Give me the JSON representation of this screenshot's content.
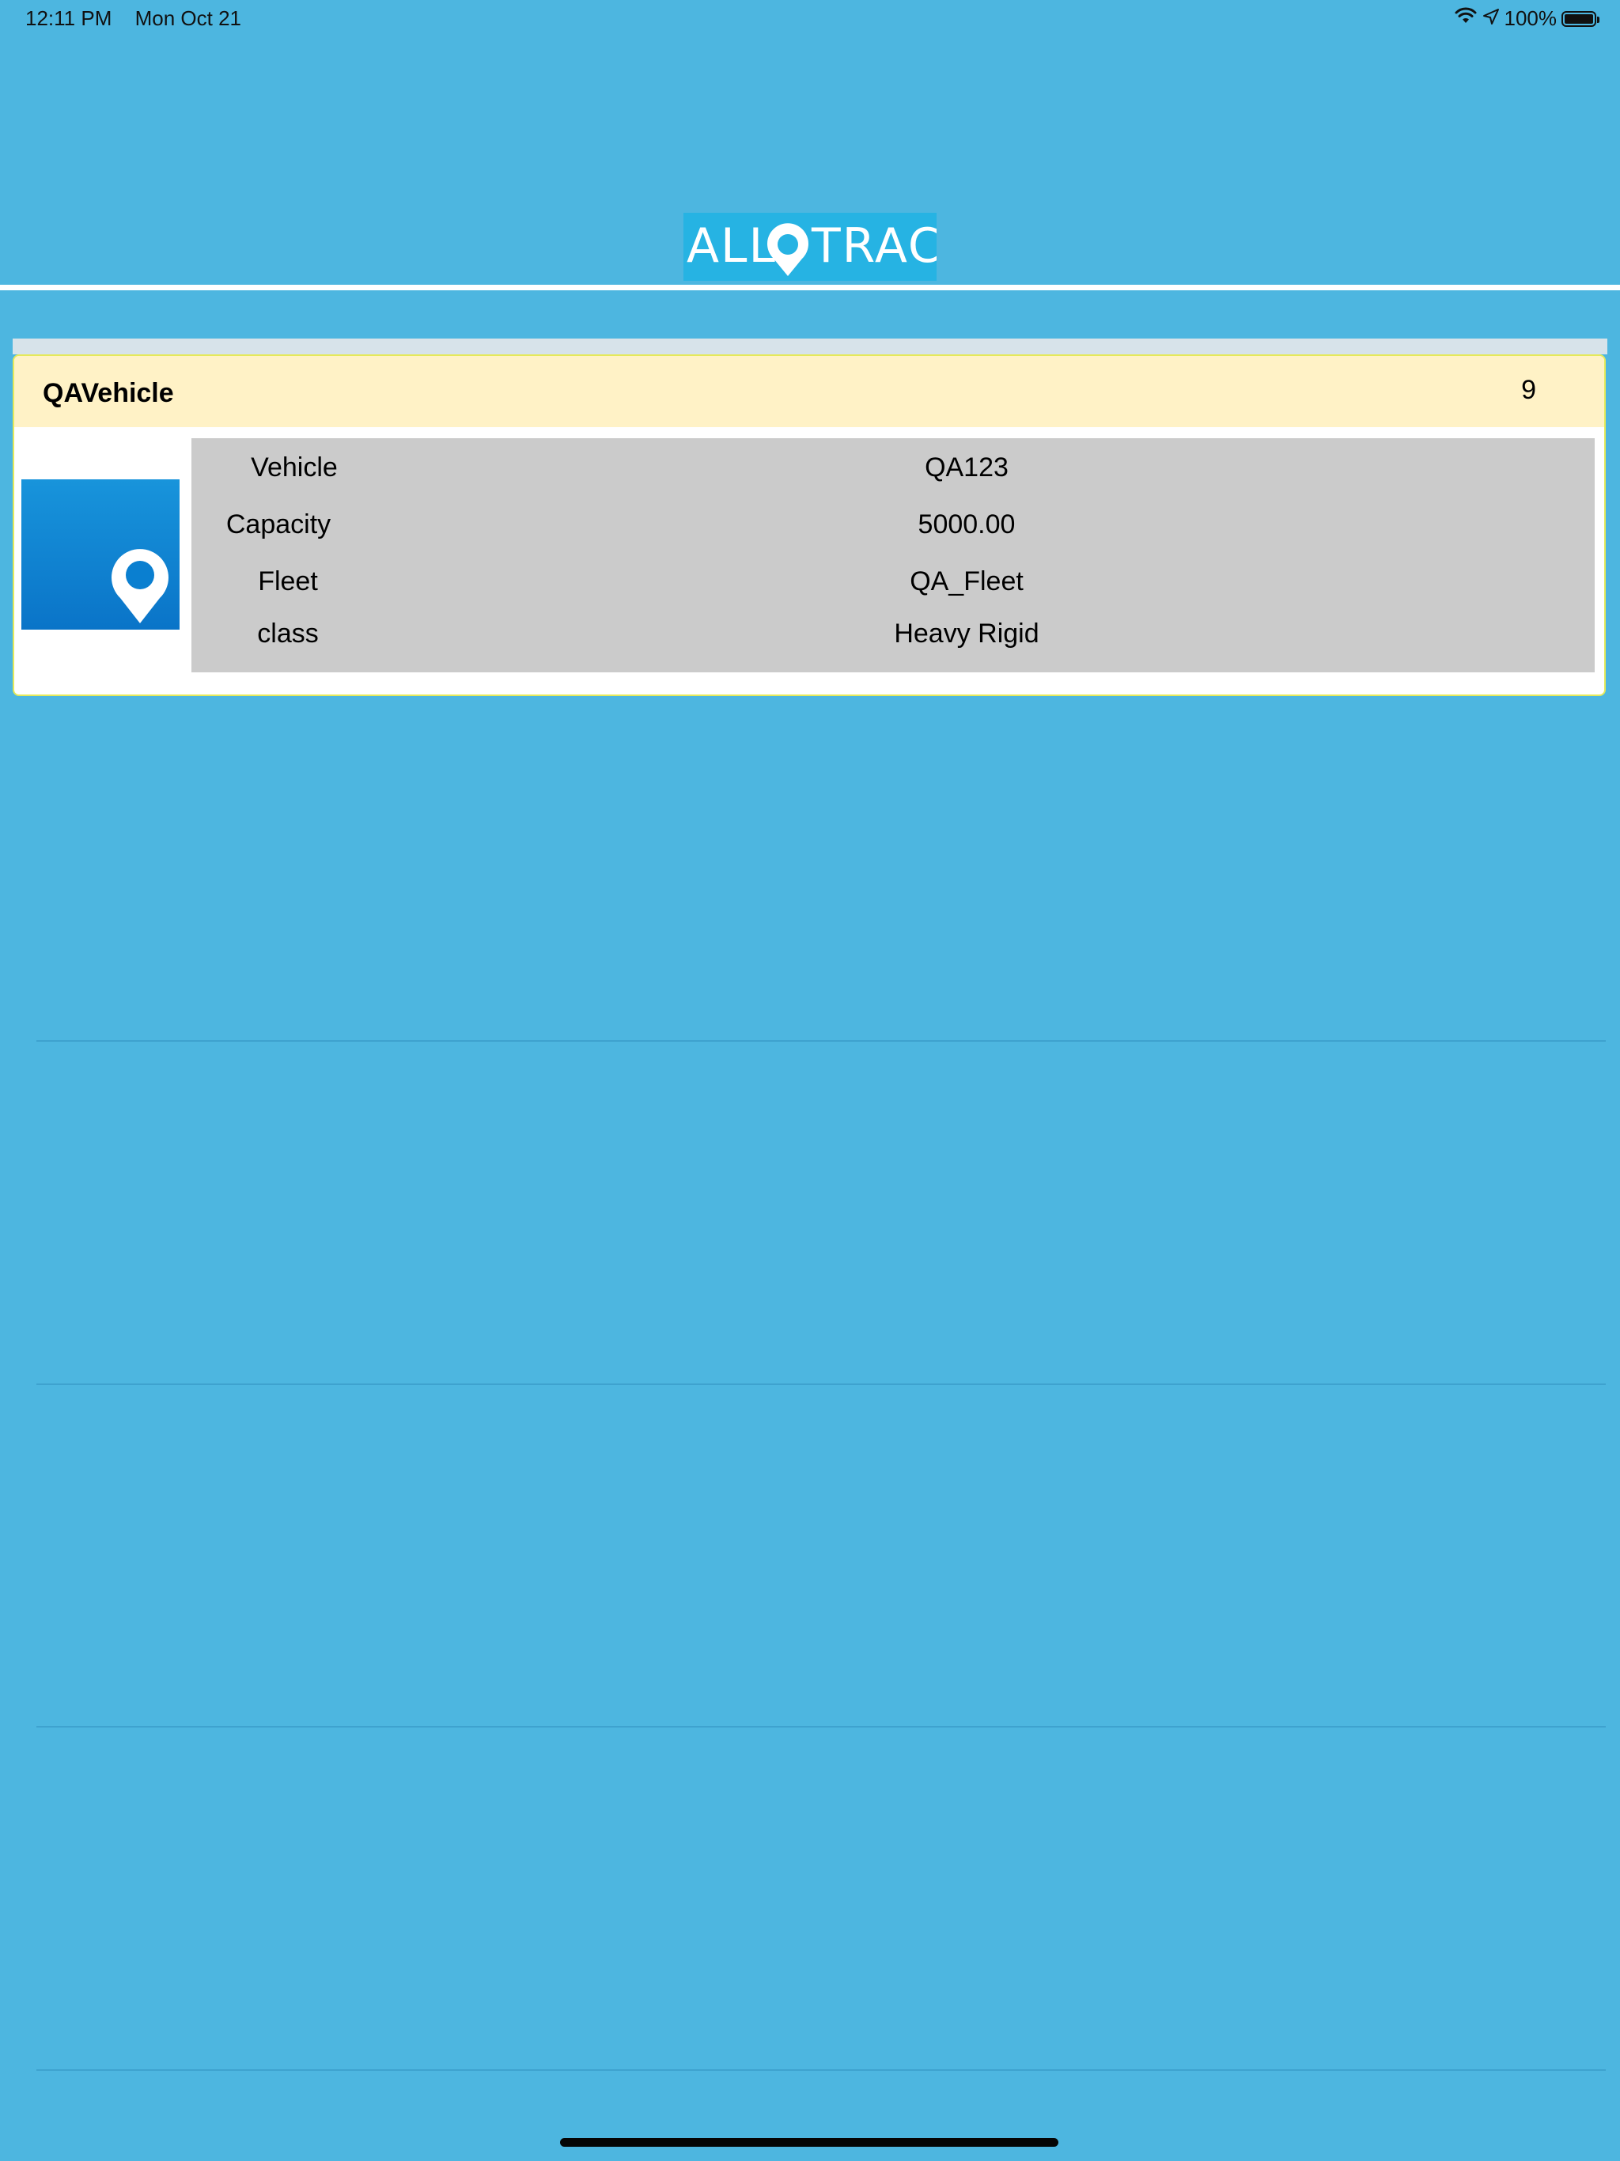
{
  "status_bar": {
    "time": "12:11 PM",
    "date": "Mon Oct 21",
    "battery": "100%"
  },
  "header": {
    "logo_text": "ALL TRAC"
  },
  "vehicle_card": {
    "title": "QAVehicle",
    "count": "9",
    "rows": [
      {
        "label": "Vehicle",
        "value": "QA123"
      },
      {
        "label": "Capacity",
        "value": "5000.00"
      },
      {
        "label": "Fleet",
        "value": "QA_Fleet"
      },
      {
        "label": "class",
        "value": "Heavy Rigid"
      }
    ]
  },
  "colors": {
    "background": "#4db6e0",
    "logo_bg": "#26b3e3",
    "card_header": "#fff2c6",
    "details_bg": "#cbcbcb",
    "card_border": "#e4e95a"
  },
  "icons": {
    "wifi": "wifi-icon",
    "location": "location-arrow-icon",
    "battery": "battery-icon",
    "logo_pin": "map-pin-icon",
    "thumb_pin": "map-pin-icon"
  }
}
